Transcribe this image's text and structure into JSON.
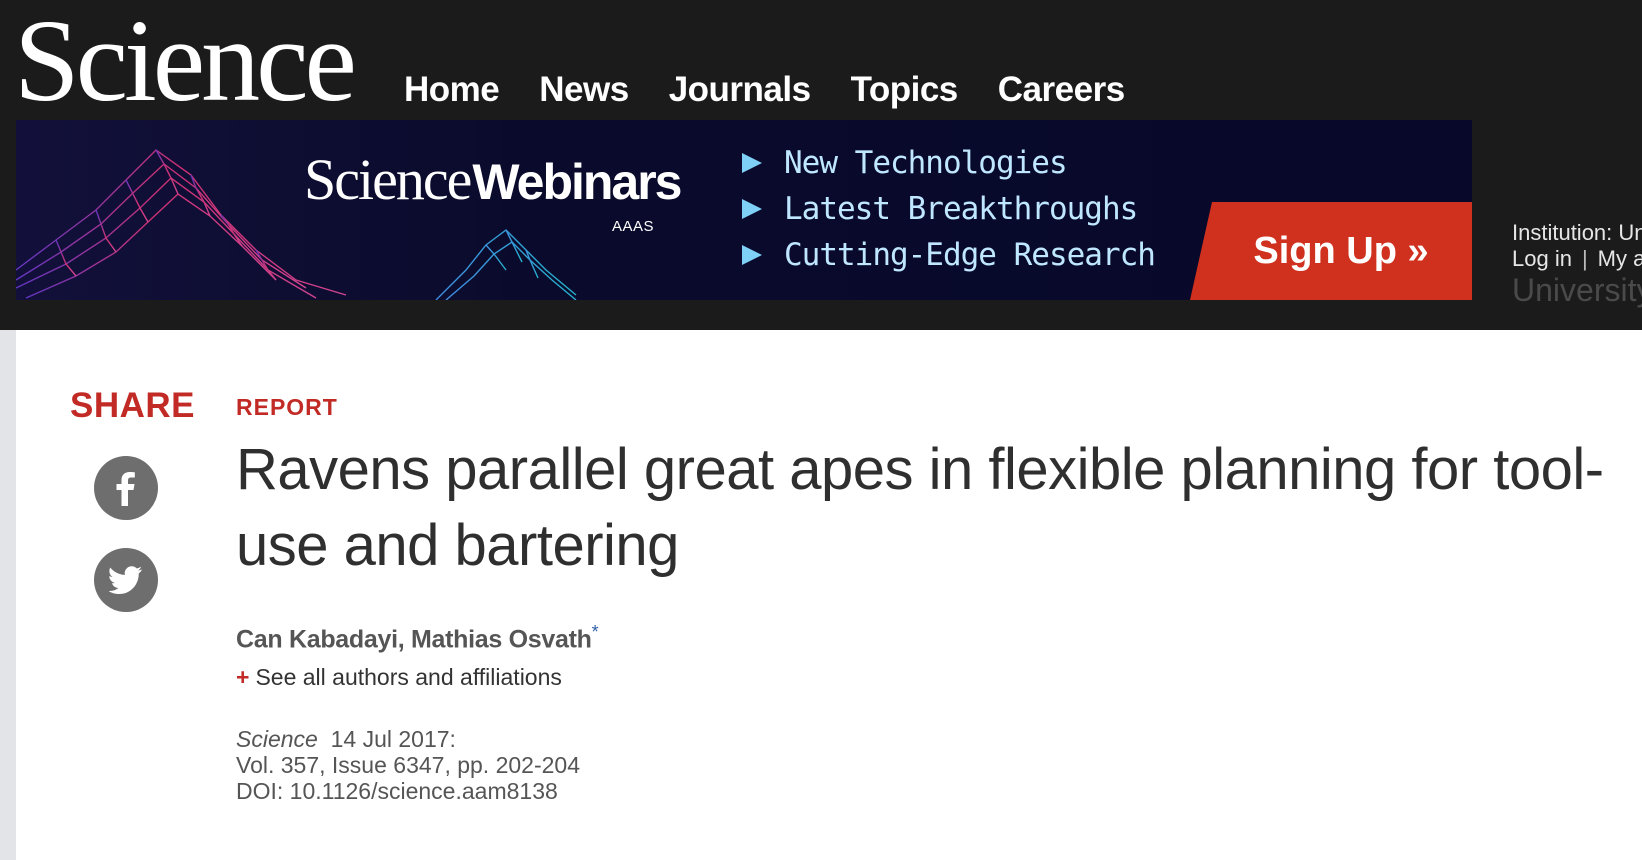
{
  "header": {
    "logo": "Science",
    "nav": [
      "Home",
      "News",
      "Journals",
      "Topics",
      "Careers"
    ]
  },
  "banner": {
    "brand_serif": "Science",
    "brand_sans": "Webinars",
    "publisher": "AAAS",
    "items": [
      "New Technologies",
      "Latest Breakthroughs",
      "Cutting-Edge Research"
    ],
    "cta": "Sign Up »",
    "colors": {
      "cta": "#d0311e",
      "items": "#bfe7ff",
      "background": "#0a0b2c"
    }
  },
  "account": {
    "institution": "Institution: Un",
    "login": "Log in",
    "separator": "|",
    "my_account": "My a",
    "university": "University"
  },
  "share": {
    "label": "SHARE",
    "buttons": [
      "facebook-icon",
      "twitter-icon"
    ]
  },
  "article": {
    "type": "REPORT",
    "title": "Ravens parallel great apes in flexible planning for tool-use and bartering",
    "authors": "Can Kabadayi, Mathias Osvath",
    "author_marker": "*",
    "affiliations_prefix": "+",
    "affiliations_link": "See all authors and affiliations",
    "journal": "Science",
    "date": "14 Jul 2017:",
    "volume": "Vol. 357, Issue 6347, pp. 202-204",
    "doi": "DOI: 10.1126/science.aam8138"
  },
  "colors": {
    "accent": "#c22b25",
    "header_bg": "#1b1b1b"
  }
}
